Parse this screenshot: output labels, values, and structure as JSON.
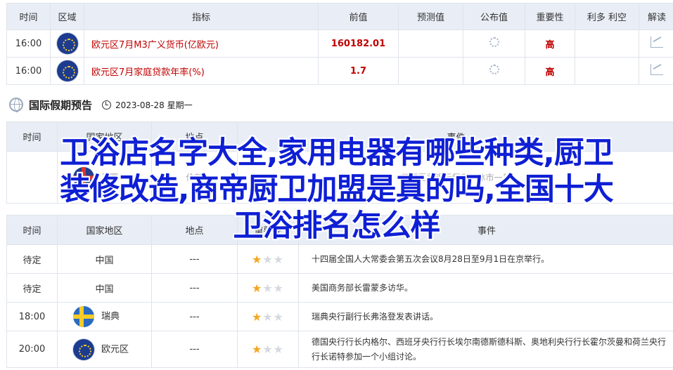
{
  "table1": {
    "headers": [
      "时间",
      "区域",
      "指标",
      "前值",
      "预测值",
      "公布值",
      "重要性",
      "利多 利空",
      "解读"
    ],
    "rows": [
      {
        "time": "16:00",
        "flag_icon": "eu-flag-icon",
        "indicator": "欧元区7月M3广义货币(亿欧元)",
        "previous": "160182.01",
        "forecast": "",
        "importance": "高"
      },
      {
        "time": "16:00",
        "flag_icon": "eu-flag-icon",
        "indicator": "欧元区7月家庭贷款年率(%)",
        "previous": "1.7",
        "forecast": "",
        "importance": "高"
      }
    ]
  },
  "holiday": {
    "title": "国际假期预告",
    "date": "2023-08-28 星期一"
  },
  "table2": {
    "headers": [
      "时间",
      "国家地区",
      "地点",
      "事件"
    ],
    "row": {
      "time": "",
      "country": "英国",
      "place": "伦敦",
      "event": "英国夏季银行假日，休市一日"
    }
  },
  "overlay": {
    "lines": [
      "卫浴店名字大全,家用电器有哪些种类,厨卫",
      "装修改造,商帝厨卫加盟是真的吗,全国十大",
      "卫浴排名怎么样"
    ]
  },
  "table3": {
    "headers": [
      "时间",
      "国家地区",
      "地点",
      "重要性",
      "事件"
    ],
    "rows": [
      {
        "time": "待定",
        "country": "中国",
        "place": "---",
        "stars": 1,
        "event": "十四届全国人大常委会第五次会议8月28日至9月1日在京举行。"
      },
      {
        "time": "待定",
        "country": "中国",
        "place": "---",
        "stars": 1,
        "event": "美国商务部长雷蒙多访华。"
      },
      {
        "time": "18:00",
        "country": "瑞典",
        "place": "---",
        "stars": 1,
        "event": "瑞典央行副行长弗洛登发表讲话。"
      },
      {
        "time": "20:00",
        "country": "欧元区",
        "place": "---",
        "stars": 1,
        "event": "德国央行行长内格尔、西班牙央行行长埃尔南德斯德科斯、奥地利央行行长霍尔茨曼和荷兰央行行长诺特参加一个小组讨论。"
      }
    ]
  }
}
